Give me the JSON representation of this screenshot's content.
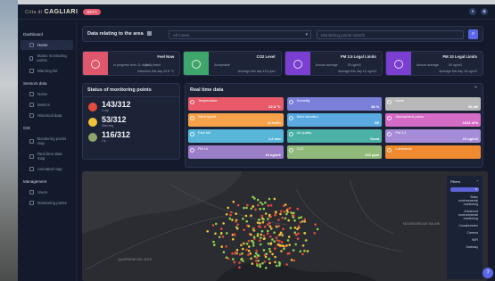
{
  "brand": {
    "prefix": "Citta di",
    "name": "CAGLIARI",
    "badge": "BETA"
  },
  "sidebar": {
    "sections": [
      {
        "label": "Dashboard",
        "items": [
          {
            "label": "Home",
            "active": true
          },
          {
            "label": "Status monitoring points"
          },
          {
            "label": "Warning list"
          }
        ]
      },
      {
        "label": "Sensors data",
        "items": [
          {
            "label": "Noise"
          },
          {
            "label": "Metrics"
          },
          {
            "label": "Historical data"
          }
        ]
      },
      {
        "label": "GIS",
        "items": [
          {
            "label": "Monitoring points map"
          },
          {
            "label": "Real time data map"
          },
          {
            "label": "Animated map"
          }
        ]
      },
      {
        "label": "Management",
        "items": [
          {
            "label": "Users"
          },
          {
            "label": "Monitoring points"
          }
        ]
      }
    ]
  },
  "filterbar": {
    "title": "Data relating to the area",
    "area_placeholder": "All zones",
    "search_placeholder": "Monitoring points search"
  },
  "summary_cards": [
    {
      "title": "Feel Now",
      "left": "In progress from 11 days",
      "mid": "Daily trend",
      "right": "Selection this day 22.8 °C",
      "color": "#e0566b"
    },
    {
      "title": "CO2 Level",
      "left": "Acceptable",
      "mid": "",
      "right": "Average this day 413 ppm",
      "color": "#3fa66b"
    },
    {
      "title": "PM 2.5 Legal Limits",
      "left": "Annual average",
      "mid": "25 ug/m3",
      "right": "Average this day 10 ug/m3",
      "color": "#7a3fd1"
    },
    {
      "title": "PM 10 Legal Limits",
      "left": "Annual average",
      "mid": "40 ug/m3",
      "right": "Average this day 18 ug/m3",
      "color": "#7a3fd1"
    }
  ],
  "status": {
    "title": "Status of monitoring points",
    "items": [
      {
        "value": "143/312",
        "label": "Critic",
        "color": "#e34b3b"
      },
      {
        "value": "53/312",
        "label": "Warning",
        "color": "#f0c23a"
      },
      {
        "value": "116/312",
        "label": "Ok",
        "color": "#8fa46a"
      }
    ]
  },
  "realtime": {
    "title": "Real time data",
    "tiles": [
      {
        "name": "Temperature",
        "value": "22.8 °C",
        "color": "#e85a6a"
      },
      {
        "name": "Humidity",
        "value": "58 %",
        "color": "#7a7fd8"
      },
      {
        "name": "Noise",
        "value": "58 dB",
        "color": "#b8b8b8"
      },
      {
        "name": "Wind speed",
        "value": "12 km/h",
        "color": "#f5a24a"
      },
      {
        "name": "Wind direction",
        "value": "SE",
        "color": "#5aa9e0"
      },
      {
        "name": "Atmospheric press.",
        "value": "1013 hPa",
        "color": "#d46bc4"
      },
      {
        "name": "Rain fall",
        "value": "1.2 mm",
        "color": "#58b6d8"
      },
      {
        "name": "Air quality",
        "value": "Good",
        "color": "#4ab0a8"
      },
      {
        "name": "PM 2.5",
        "value": "10 ug/m3",
        "color": "#a58bd8"
      },
      {
        "name": "PM 10",
        "value": "18 ug/m3",
        "color": "#9a7ec8"
      },
      {
        "name": "CO2",
        "value": "413 ppm",
        "color": "#8fba7a"
      },
      {
        "name": "Luminance",
        "value": "",
        "color": "#f08a2e"
      }
    ]
  },
  "map": {
    "labels": [
      "QUARTIERE DEL SOLE",
      "MOLENTARGIUS SALINE"
    ],
    "filters": {
      "title": "Filters",
      "options": [
        "Basic environmental monitoring",
        "Advanced environmental monitoring",
        "Crossbreezes",
        "Camera",
        "WiFi",
        "Gateway"
      ]
    }
  }
}
